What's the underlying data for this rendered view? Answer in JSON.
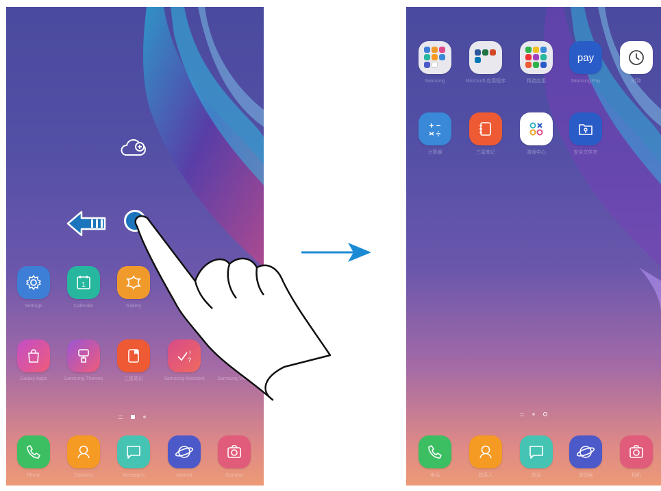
{
  "left_screen": {
    "row1": [
      {
        "icon": "settings-icon",
        "label": "Settings",
        "color": "#3d7fd6"
      },
      {
        "icon": "calendar-icon",
        "label": "Calendar",
        "color": "#27b69e",
        "day": "1"
      },
      {
        "icon": "gallery-icon",
        "label": "Gallery",
        "color": "#f19a2c"
      }
    ],
    "row2": [
      {
        "icon": "galaxy-apps-icon",
        "label": "Galaxy Apps",
        "color": "#e04a8a"
      },
      {
        "icon": "samsung-themes-icon",
        "label": "Samsung Themes",
        "color": "#e9577a"
      },
      {
        "icon": "notes-icon",
        "label": "三星笔记",
        "color": "#ee5a34"
      },
      {
        "icon": "samsung-assistant-icon",
        "label": "Samsung Assistant",
        "color": "#e84d6e"
      },
      {
        "icon": "video-icon",
        "label": "Samsung Video",
        "color": "#e06070"
      }
    ],
    "dock": [
      {
        "icon": "phone-icon",
        "label": "Phone",
        "color": "#3bbf62"
      },
      {
        "icon": "contacts-icon",
        "label": "Contacts",
        "color": "#f59a23"
      },
      {
        "icon": "messages-icon",
        "label": "Messages",
        "color": "#45c4b4"
      },
      {
        "icon": "internet-icon",
        "label": "Internet",
        "color": "#4c5ac9"
      },
      {
        "icon": "camera-icon",
        "label": "Camera",
        "color": "#e15b7a"
      }
    ]
  },
  "right_screen": {
    "row1": [
      {
        "icon": "samsung-folder-icon",
        "label": "Samsung"
      },
      {
        "icon": "microsoft-folder-icon",
        "label": "Microsoft 应用程序"
      },
      {
        "icon": "apps-folder-icon",
        "label": "精选应用"
      },
      {
        "icon": "samsung-pay-icon",
        "label": "Samsung Pay",
        "text": "pay",
        "color": "#2a5cc8"
      },
      {
        "icon": "clock-icon",
        "label": "时钟",
        "color": "#ffffff"
      }
    ],
    "row2": [
      {
        "icon": "calculator-icon",
        "label": "计算器",
        "color": "#3a88d8"
      },
      {
        "icon": "memo-icon",
        "label": "三星笔记",
        "color": "#ee5a34"
      },
      {
        "icon": "game-center-icon",
        "label": "游戏中心",
        "color": "#ffffff"
      },
      {
        "icon": "secure-folder-icon",
        "label": "安全文件夹",
        "color": "#2a5cc8"
      }
    ],
    "dock": [
      {
        "icon": "phone-icon",
        "label": "电话",
        "color": "#3bbf62"
      },
      {
        "icon": "contacts-icon",
        "label": "联系人",
        "color": "#f59a23"
      },
      {
        "icon": "messages-icon",
        "label": "信息",
        "color": "#45c4b4"
      },
      {
        "icon": "internet-icon",
        "label": "浏览器",
        "color": "#4c5ac9"
      },
      {
        "icon": "camera-icon",
        "label": "相机",
        "color": "#e15b7a"
      }
    ]
  },
  "gesture": {
    "direction": "swipe-left",
    "cloud_icon": "add-page-cloud-icon"
  },
  "transition_arrow_color": "#1b8ad4",
  "swipe_arrow_color": "#1b75bc"
}
